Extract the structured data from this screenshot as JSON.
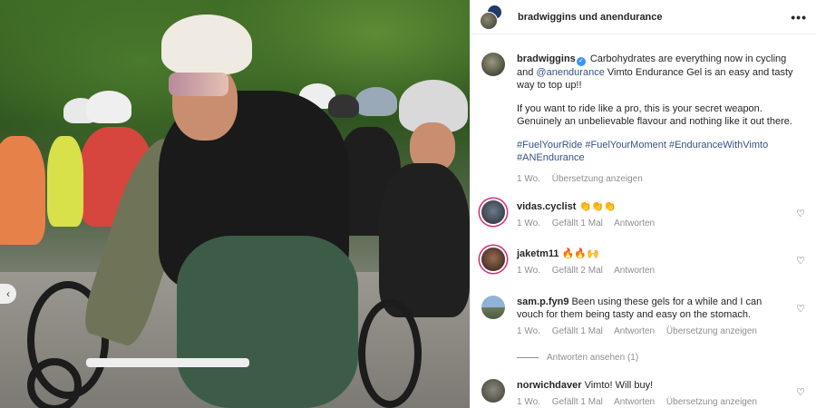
{
  "header": {
    "title": "bradwiggins und anendurance",
    "more_icon": "more-horizontal-icon"
  },
  "post": {
    "username": "bradwiggins",
    "text_1": " Carbohydrates are everything now in cycling and ",
    "mention": "@anendurance",
    "text_2": " Vimto Endurance Gel is an easy and tasty way to top up!!",
    "paragraph_2": "If you want to ride like a pro, this is your secret weapon. Genuinely an unbelievable flavour and nothing like it out there.",
    "hashtags": "#FuelYourRide #FuelYourMoment #EnduranceWithVimto #ANEndurance",
    "time": "1 Wo.",
    "translate": "Übersetzung anzeigen"
  },
  "comments": [
    {
      "username": "vidas.cyclist",
      "text": "👏👏👏",
      "time": "1 Wo.",
      "likes": "Gefällt 1 Mal",
      "reply": "Antworten",
      "translate": ""
    },
    {
      "username": "jaketm11",
      "text": "🔥🔥🙌",
      "time": "1 Wo.",
      "likes": "Gefällt 2 Mal",
      "reply": "Antworten",
      "translate": ""
    },
    {
      "username": "sam.p.fyn9",
      "text": "Been using these gels for a while and I can vouch for them being tasty and easy on the stomach.",
      "time": "1 Wo.",
      "likes": "Gefällt 1 Mal",
      "reply": "Antworten",
      "translate": "Übersetzung anzeigen"
    },
    {
      "username": "norwichdaver",
      "text": "Vimto! Will buy!",
      "time": "1 Wo.",
      "likes": "Gefällt 1 Mal",
      "reply": "Antworten",
      "translate": "Übersetzung anzeigen"
    }
  ],
  "view_replies": "Antworten ansehen (1)",
  "colors": {
    "link": "#385185",
    "muted": "#8e8e8e",
    "verified": "#3897f0",
    "story_ring": "#d62976"
  }
}
